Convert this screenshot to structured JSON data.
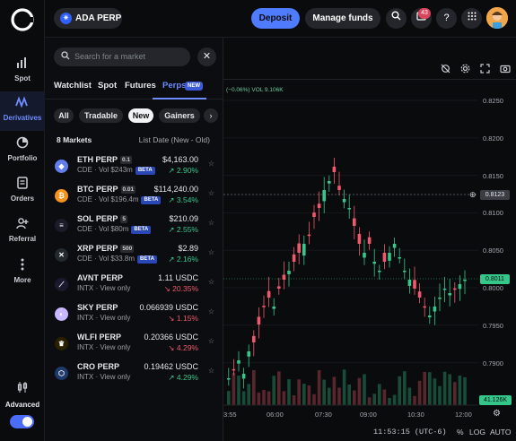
{
  "rail": {
    "items": [
      {
        "label": "Spot",
        "icon": "bar-chart-icon"
      },
      {
        "label": "Derivatives",
        "icon": "wave-icon",
        "active": true
      },
      {
        "label": "Portfolio",
        "icon": "pie-icon"
      },
      {
        "label": "Orders",
        "icon": "document-icon"
      },
      {
        "label": "Referral",
        "icon": "person-plus-icon"
      },
      {
        "label": "More",
        "icon": "dots-icon"
      }
    ],
    "advanced_label": "Advanced",
    "advanced_on": true
  },
  "topbar": {
    "pair": "ADA PERP",
    "deposit": "Deposit",
    "manage": "Manage funds",
    "notification_count": "43"
  },
  "panel": {
    "search_placeholder": "Search for a market",
    "tabs": [
      "Watchlist",
      "Spot",
      "Futures",
      "Perps"
    ],
    "active_tab": "Perps",
    "new_tag": "NEW",
    "chips": [
      "All",
      "Tradable",
      "New",
      "Gainers"
    ],
    "selected_chip": "New",
    "count": "8 Markets",
    "sort": "List Date (New - Old)",
    "markets": [
      {
        "name": "ETH PERP",
        "lev": "0.1",
        "sub": "CDE · Vol $243m",
        "beta": "BETA",
        "price": "$4,163.00",
        "change": "↗ 2.90%",
        "dir": "up",
        "icon": "ethereum-icon",
        "color": "#627eea",
        "glyph": "◆"
      },
      {
        "name": "BTC PERP",
        "lev": "0.01",
        "sub": "CDE · Vol $196.4m",
        "beta": "BETA",
        "price": "$114,240.00",
        "change": "↗ 3.54%",
        "dir": "up",
        "icon": "bitcoin-icon",
        "color": "#f7931a",
        "glyph": "₿"
      },
      {
        "name": "SOL PERP",
        "lev": "5",
        "sub": "CDE · Vol $80m",
        "beta": "BETA",
        "price": "$210.09",
        "change": "↗ 2.55%",
        "dir": "up",
        "icon": "solana-icon",
        "color": "#1b1b2a",
        "glyph": "≡"
      },
      {
        "name": "XRP PERP",
        "lev": "500",
        "sub": "CDE · Vol $33.8m",
        "beta": "BETA",
        "price": "$2.89",
        "change": "↗ 2.16%",
        "dir": "up",
        "icon": "xrp-icon",
        "color": "#23292f",
        "glyph": "✕"
      },
      {
        "name": "AVNT PERP",
        "lev": "",
        "sub": "INTX · View only",
        "beta": "",
        "price": "1.11 USDC",
        "change": "↘ 20.35%",
        "dir": "down",
        "icon": "avantis-icon",
        "color": "#1a1a2e",
        "glyph": "⟋"
      },
      {
        "name": "SKY PERP",
        "lev": "",
        "sub": "INTX · View only",
        "beta": "",
        "price": "0.066939 USDC",
        "change": "↘ 1.15%",
        "dir": "down",
        "icon": "sky-icon",
        "color": "#c9b8ff",
        "glyph": "◐"
      },
      {
        "name": "WLFI PERP",
        "lev": "",
        "sub": "INTX · View only",
        "beta": "",
        "price": "0.20366 USDC",
        "change": "↘ 4.29%",
        "dir": "down",
        "icon": "wlfi-icon",
        "color": "#2a2000",
        "glyph": "♛"
      },
      {
        "name": "CRO PERP",
        "lev": "",
        "sub": "INTX · View only",
        "beta": "",
        "price": "0.19462 USDC",
        "change": "↗ 4.29%",
        "dir": "up",
        "icon": "cronos-icon",
        "color": "#1d3a6b",
        "glyph": "⬡"
      }
    ]
  },
  "chart": {
    "legend": "(−0.06%)  VOL 9.106K",
    "y_ticks": [
      "0.8250",
      "0.8200",
      "0.8150",
      "0.8100",
      "0.8050",
      "0.8000",
      "0.7950",
      "0.7900"
    ],
    "x_ticks": [
      "3:55",
      "06:00",
      "07:30",
      "09:00",
      "10:30",
      "12:00"
    ],
    "crosshair_price": "0.8123",
    "last_price": "0.8011",
    "volume_label": "41.126K",
    "clock": "11:53:15 (UTC-6)",
    "pct": "%",
    "log": "LOG",
    "auto": "AUTO",
    "up_color": "#35c78a",
    "down_color": "#f0596d"
  }
}
